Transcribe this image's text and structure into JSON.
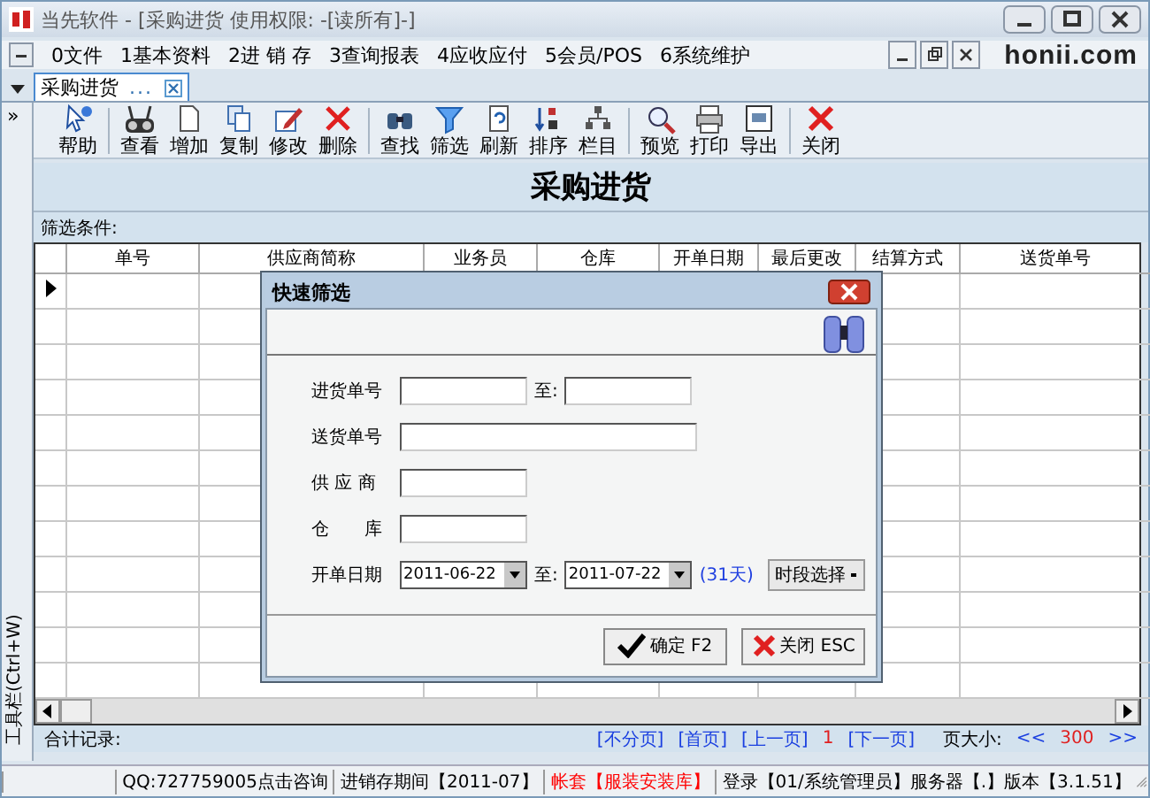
{
  "window": {
    "title": "当先软件 - [采购进货 使用权限: -[读所有]-]"
  },
  "menu": [
    "0文件",
    "1基本资料",
    "2进 销 存",
    "3查询报表",
    "4应收应付",
    "5会员/POS",
    "6系统维护"
  ],
  "logo": "honii.com",
  "tabs": [
    {
      "label": "采购进货",
      "more": "...",
      "selected": true
    }
  ],
  "side_toggle": "»",
  "toolbar": [
    [
      "帮助"
    ],
    [
      "查看",
      "增加",
      "复制",
      "修改",
      "删除"
    ],
    [
      "查找",
      "筛选",
      "刷新",
      "排序",
      "栏目"
    ],
    [
      "预览",
      "打印",
      "导出"
    ],
    [
      "关闭"
    ]
  ],
  "heading": "采购进货",
  "filter_label": "筛选条件:",
  "table": {
    "columns": [
      "单号",
      "供应商简称",
      "业务员",
      "仓库",
      "开单日期",
      "最后更改",
      "结算方式",
      "送货单号"
    ]
  },
  "side_label": "工具栏(Ctrl+W)",
  "footer": {
    "total": "合计记录:",
    "links": [
      {
        "label": "[不分页]",
        "kind": "link"
      },
      {
        "label": "[首页]",
        "kind": "link"
      },
      {
        "label": "[上一页]",
        "kind": "link"
      },
      {
        "label": "1",
        "kind": "page"
      },
      {
        "label": "[下一页]",
        "kind": "link"
      }
    ],
    "size_label": "页大小:",
    "prev": "<<",
    "size": "300",
    "next": ">>"
  },
  "status_bar": [
    {
      "text": "QQ:727759005点击咨询",
      "color": "#000000"
    },
    {
      "text": "进销存期间【2011-07】",
      "color": "#000000"
    },
    {
      "text": "帐套【服装安装库】",
      "color": "#ff0000"
    },
    {
      "text": "登录【01/系统管理员】服务器【.】版本【3.1.51】",
      "color": "#000000"
    }
  ],
  "dialog": {
    "title": "快速筛选",
    "rows": [
      {
        "label": "进货单号",
        "kind": "range",
        "to": "至:"
      },
      {
        "label": "送货单号",
        "kind": "wide"
      },
      {
        "label": "供 应 商",
        "kind": "short"
      },
      {
        "label": "仓　　库",
        "kind": "short"
      },
      {
        "label": "开单日期",
        "kind": "dates",
        "from_value": "2011-06-22",
        "to": "至:",
        "to_value": "2011-07-22",
        "days": "(31天)",
        "button": "时段选择"
      }
    ],
    "buttons": [
      {
        "label": "确定 F2",
        "kind": "ok"
      },
      {
        "label": "关闭 ESC",
        "kind": "close"
      }
    ]
  }
}
